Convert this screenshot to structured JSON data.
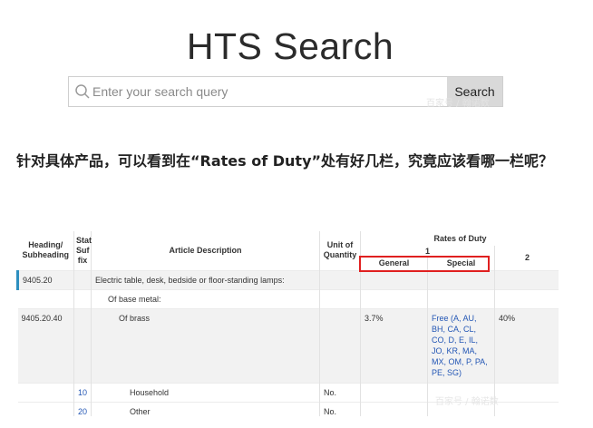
{
  "page": {
    "title": "HTS Search"
  },
  "search": {
    "placeholder": "Enter your search query",
    "button_label": "Search",
    "watermark": "百家号 / 翰诺数"
  },
  "question": {
    "text": "针对具体产品，可以看到在“Rates of Duty”处有好几栏，究竟应该看哪一栏呢？"
  },
  "table": {
    "headers": {
      "heading": "Heading/ Subheading",
      "stat": "Stat Suf fix",
      "desc": "Article Description",
      "unit": "Unit of Quantity",
      "rates": "Rates of Duty",
      "col1": "1",
      "general": "General",
      "special": "Special",
      "col2": "2"
    },
    "rows": [
      {
        "heading": "9405.20",
        "stat": "",
        "desc": "Electric table, desk, bedside or floor-standing lamps:",
        "unit": "",
        "general": "",
        "special": "",
        "col2": ""
      },
      {
        "heading": "",
        "stat": "",
        "desc": "Of base metal:",
        "unit": "",
        "general": "",
        "special": "",
        "col2": ""
      },
      {
        "heading": "9405.20.40",
        "stat": "",
        "desc": "Of brass",
        "unit": "",
        "general": "3.7%",
        "special": "Free (A, AU, BH, CA, CL, CO, D, E, IL, JO, KR, MA, MX, OM, P, PA, PE, SG)",
        "col2": "40%"
      },
      {
        "heading": "",
        "stat": "10",
        "desc": "Household",
        "unit": "No.",
        "general": "",
        "special": "",
        "col2": ""
      },
      {
        "heading": "",
        "stat": "20",
        "desc": "Other",
        "unit": "No.",
        "general": "",
        "special": "",
        "col2": ""
      }
    ],
    "watermark": "百家号 / 翰诺数"
  },
  "colors": {
    "highlight_box": "#e02020",
    "link": "#2457b5",
    "accent_bar": "#2d8fbf"
  }
}
